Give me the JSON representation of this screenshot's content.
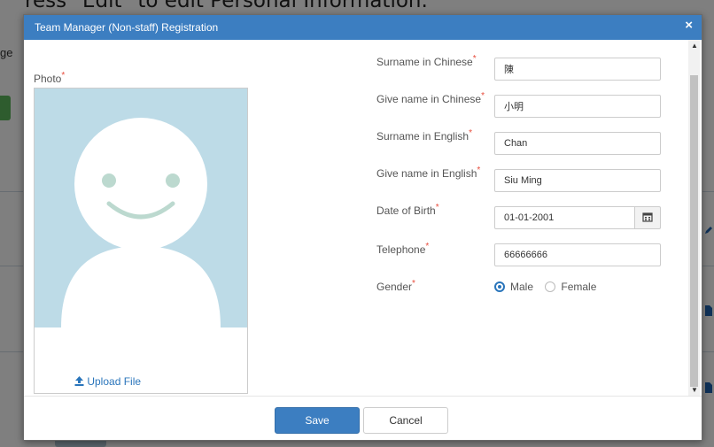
{
  "background": {
    "heading": "ress \"Edit\" to edit Personal Information.",
    "fragment": "ge"
  },
  "modal": {
    "title": "Team Manager (Non-staff) Registration",
    "close_label": "×"
  },
  "photo": {
    "label": "Photo",
    "required_mark": "*",
    "upload_label": "Upload File"
  },
  "form": {
    "fields": [
      {
        "label": "Surname in Chinese",
        "value": "陳"
      },
      {
        "label": "Give name in Chinese",
        "value": "小明"
      },
      {
        "label": "Surname in English",
        "value": "Chan"
      },
      {
        "label": "Give name in English",
        "value": "Siu Ming"
      },
      {
        "label": "Date of Birth",
        "value": "01-01-2001"
      },
      {
        "label": "Telephone",
        "value": "66666666"
      }
    ],
    "gender": {
      "label": "Gender",
      "options": [
        "Male",
        "Female"
      ],
      "selected": "Male"
    },
    "required_mark": "*"
  },
  "footer": {
    "save_label": "Save",
    "cancel_label": "Cancel"
  },
  "colors": {
    "header": "#3c7ec1",
    "primary_button": "#3c7ec1",
    "required": "#e74c3c",
    "photo_placeholder": "#bddbe7"
  },
  "icons": [
    "close-icon",
    "upload-icon",
    "calendar-icon",
    "scroll-up-icon",
    "scroll-down-icon"
  ]
}
